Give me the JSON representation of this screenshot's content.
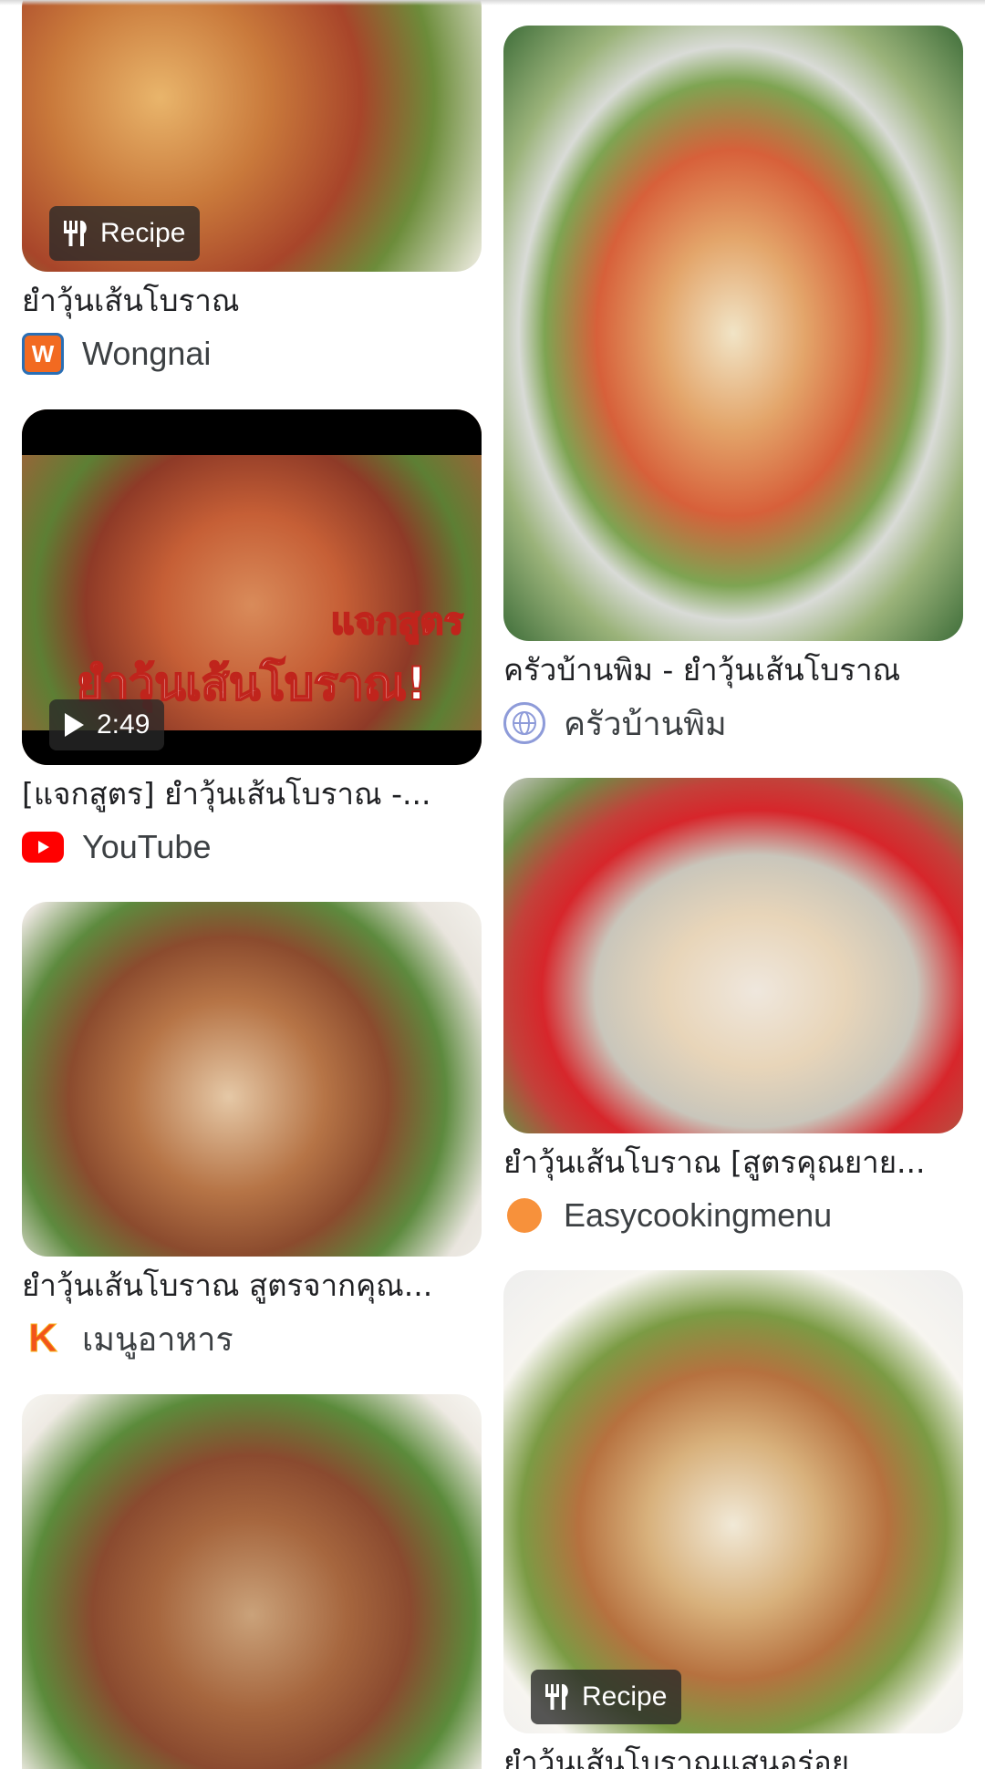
{
  "results": [
    {
      "title": "ยำวุ้นเส้นโบราณ",
      "source": "Wongnai",
      "badge": "Recipe",
      "source_icon": "wongnai-logo",
      "source_icon_letter": "W"
    },
    {
      "title": "[แจกสูตร] ยำวุ้นเส้นโบราณ -...",
      "source": "YouTube",
      "duration": "2:49",
      "overlay_title": "ยำวุ้นเส้นโบราณ!",
      "overlay_sub": "แจกสูตร",
      "source_icon": "youtube-logo"
    },
    {
      "title": "ยำวุ้นเส้นโบราณ สูตรจากคุณ...",
      "source": "เมนูอาหาร",
      "source_icon": "k-logo",
      "source_icon_letter": "K"
    },
    {
      "title": "ครัวบ้านพิม - ยำวุ้นเส้นโบราณ",
      "source": "ครัวบ้านพิม",
      "source_icon": "globe-icon"
    },
    {
      "title": "ยำวุ้นเส้นโบราณ [สูตรคุณยาย...",
      "source": "Easycookingmenu",
      "source_icon": "orange-circle-logo"
    },
    {
      "title": "ยำวุ้นเส้นโบราณแสนอร่อย",
      "badge": "Recipe"
    }
  ],
  "colors": {
    "youtube_red": "#ff0000",
    "wongnai_blue": "#2a6fb5",
    "wongnai_orange": "#f26a21",
    "easycooking_orange": "#f7913b",
    "text": "#202124"
  }
}
